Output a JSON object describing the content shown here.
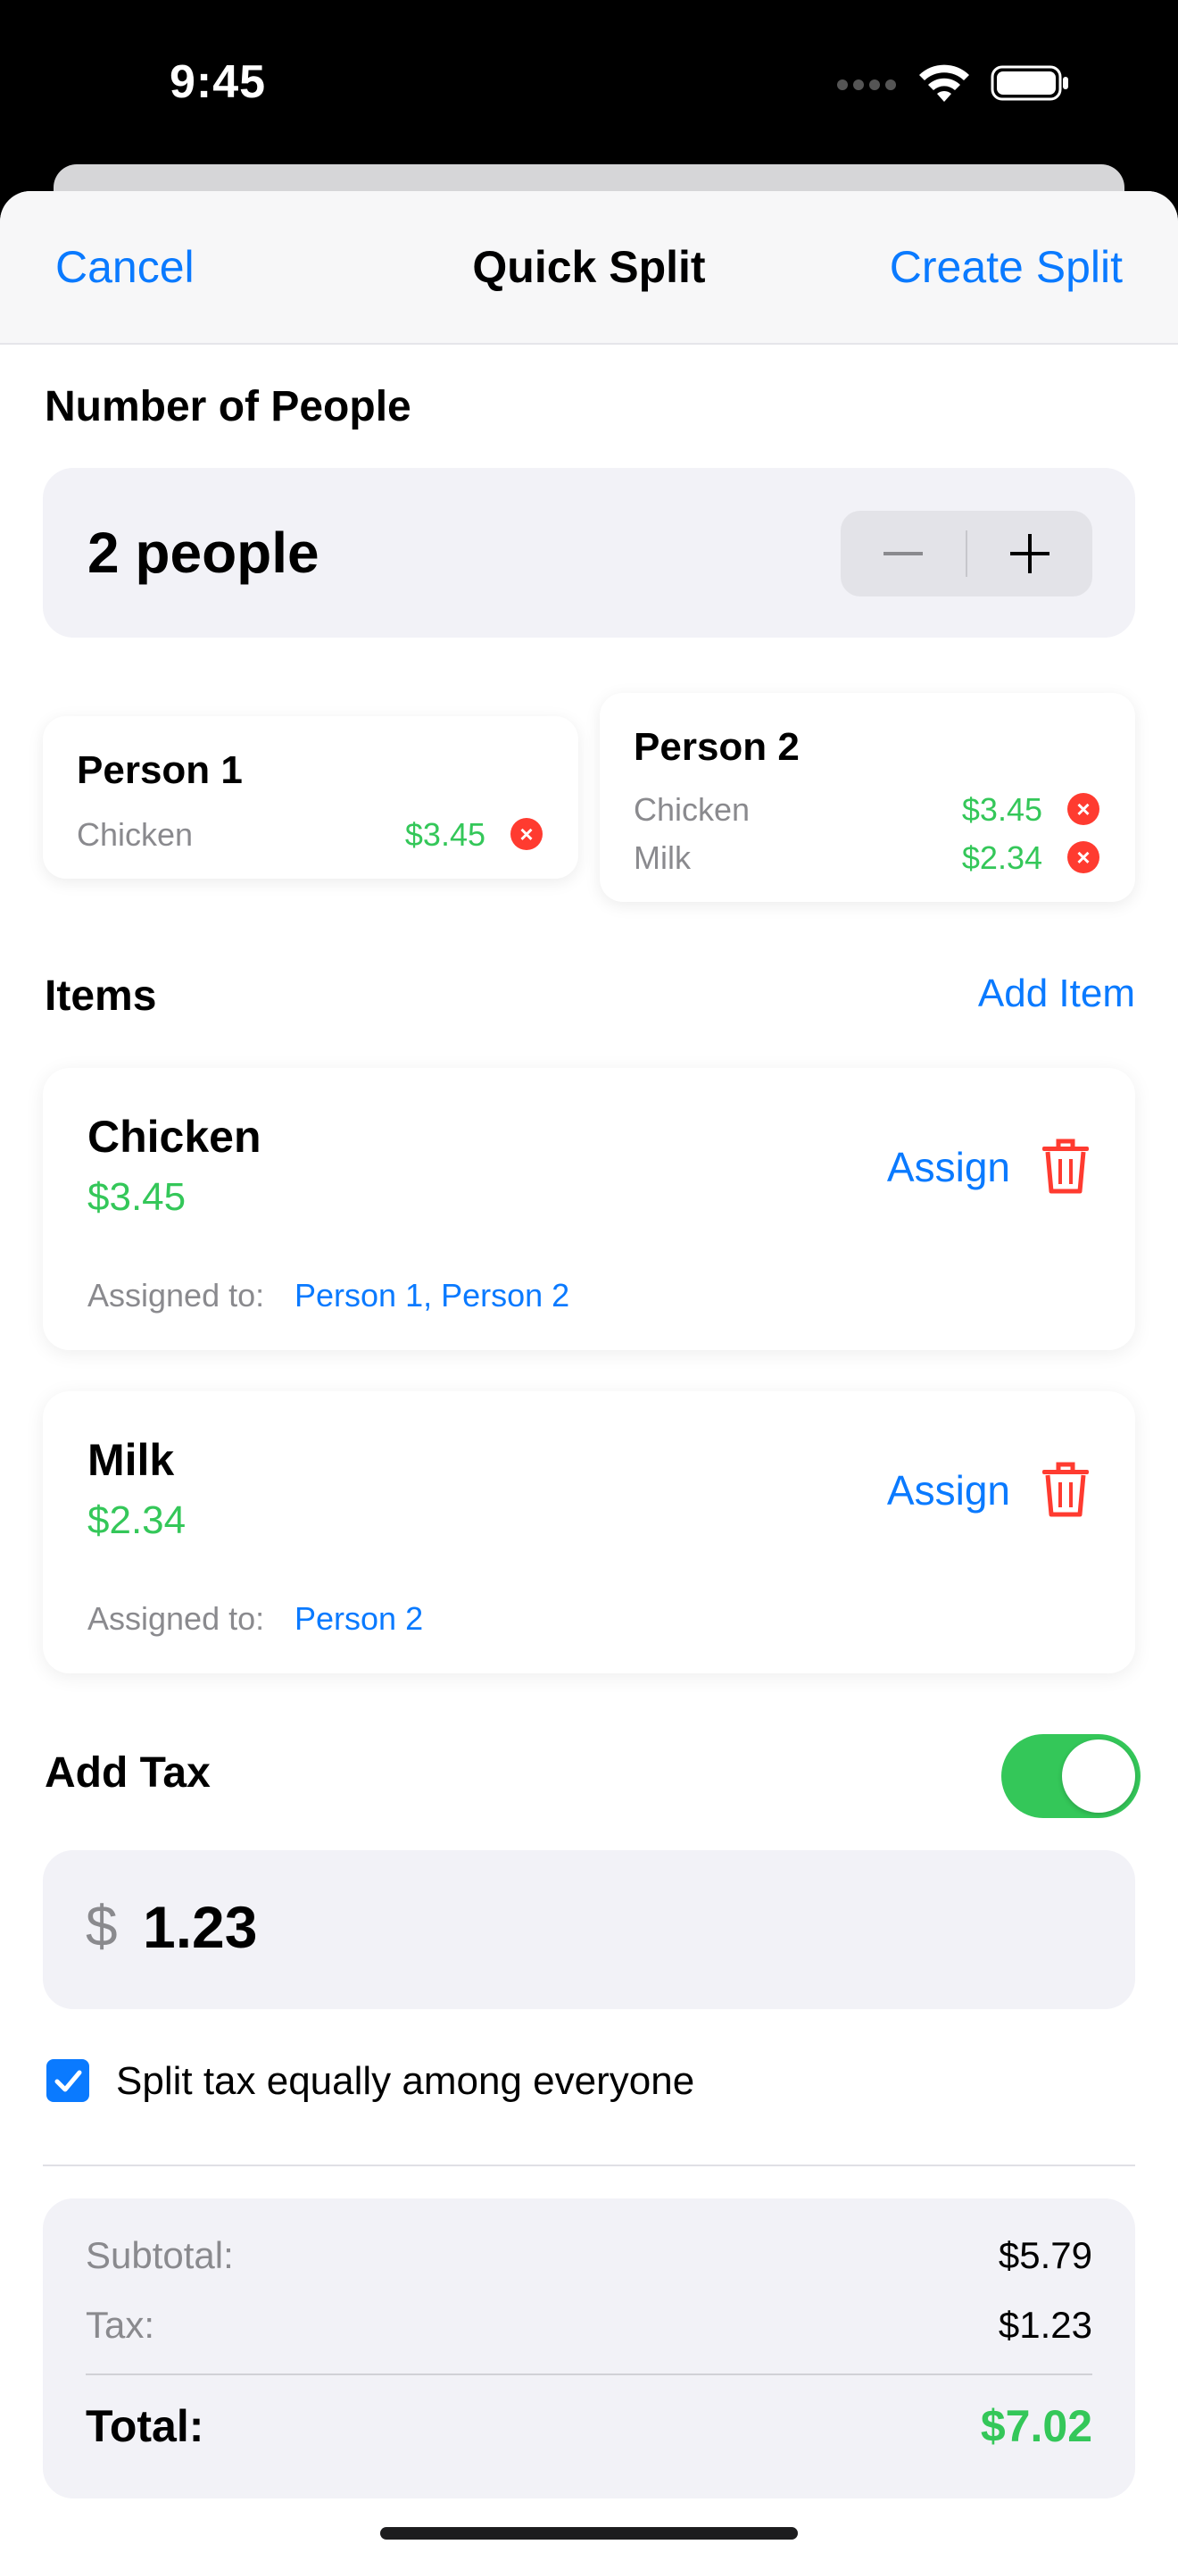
{
  "status": {
    "time": "9:45"
  },
  "nav": {
    "cancel": "Cancel",
    "title": "Quick Split",
    "create": "Create Split"
  },
  "people_section": {
    "label": "Number of People",
    "count_text": "2 people",
    "minus": "−",
    "plus": "+"
  },
  "persons": [
    {
      "name": "Person 1",
      "items": [
        {
          "name": "Chicken",
          "price": "$3.45"
        }
      ]
    },
    {
      "name": "Person 2",
      "items": [
        {
          "name": "Chicken",
          "price": "$3.45"
        },
        {
          "name": "Milk",
          "price": "$2.34"
        }
      ]
    }
  ],
  "remove_glyph": "×",
  "items_section": {
    "label": "Items",
    "add_label": "Add Item"
  },
  "items": [
    {
      "name": "Chicken",
      "price": "$3.45",
      "assign": "Assign",
      "assigned_label": "Assigned to:",
      "assigned_to": "Person 1, Person 2"
    },
    {
      "name": "Milk",
      "price": "$2.34",
      "assign": "Assign",
      "assigned_label": "Assigned to:",
      "assigned_to": "Person 2"
    }
  ],
  "tax": {
    "label": "Add Tax",
    "enabled": true,
    "currency": "$",
    "value": "1.23",
    "split_equally_label": "Split tax equally among everyone",
    "split_equally": true
  },
  "summary": {
    "subtotal_label": "Subtotal:",
    "subtotal": "$5.79",
    "tax_label": "Tax:",
    "tax": "$1.23",
    "total_label": "Total:",
    "total": "$7.02"
  },
  "colors": {
    "accent": "#0a7aff",
    "money": "#34c759",
    "danger": "#ff3b30"
  }
}
